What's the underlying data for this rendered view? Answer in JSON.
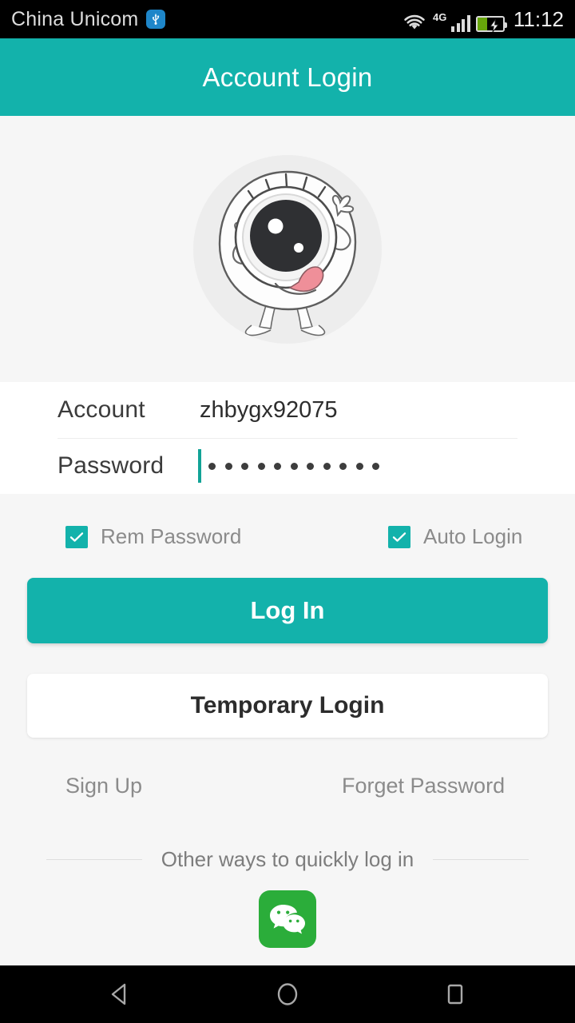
{
  "status_bar": {
    "carrier": "China Unicom",
    "usb_icon": "usb-icon",
    "wifi_icon": "wifi-icon",
    "network_type": "4G",
    "signal_icon": "signal-bars-icon",
    "battery_icon": "battery-charging-icon",
    "time": "11:12"
  },
  "header": {
    "title": "Account Login"
  },
  "avatar": {
    "icon": "cartoon-eyeball-avatar"
  },
  "form": {
    "account": {
      "label": "Account",
      "value": "zhbygx92075",
      "placeholder": "Account"
    },
    "password": {
      "label": "Password",
      "value": "•••••••••••",
      "placeholder": "Password",
      "dot_count": 11
    }
  },
  "options": {
    "remember_password": {
      "label": "Rem Password",
      "checked": true
    },
    "auto_login": {
      "label": "Auto Login",
      "checked": true
    }
  },
  "buttons": {
    "login": "Log In",
    "temporary_login": "Temporary Login"
  },
  "links": {
    "sign_up": "Sign Up",
    "forget_password": "Forget Password"
  },
  "other_ways": {
    "text": "Other ways to quickly log in",
    "wechat_icon": "wechat-icon"
  },
  "nav_bar": {
    "back": "back-icon",
    "home": "home-icon",
    "recents": "recents-icon"
  },
  "colors": {
    "accent": "#13b2ab",
    "header": "#13b2ab",
    "page_bg": "#f6f6f6",
    "card_bg": "#ffffff",
    "wechat_green": "#2bad3a",
    "battery_green": "#67a50a",
    "usb_blue": "#1e86c9",
    "muted_text": "#8b8b8b"
  }
}
